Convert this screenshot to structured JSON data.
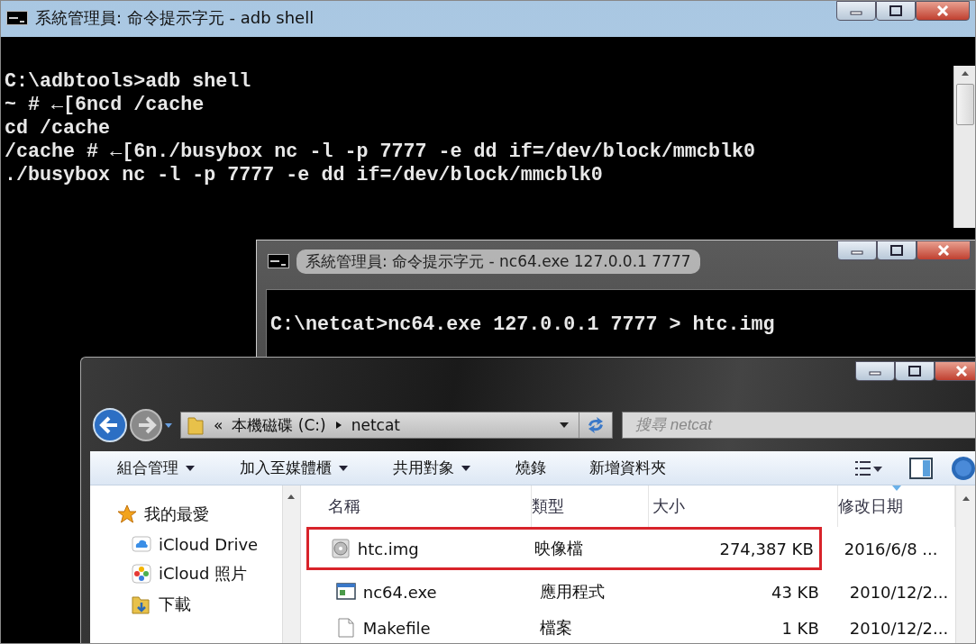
{
  "adb_window": {
    "title": "系統管理員: 命令提示字元 - adb shell",
    "lines": [
      "C:\\adbtools>adb shell",
      "~ # ←[6ncd /cache",
      "cd /cache",
      "/cache # ←[6n./busybox nc -l -p 7777 -e dd if=/dev/block/mmcblk0",
      "./busybox nc -l -p 7777 -e dd if=/dev/block/mmcblk0"
    ]
  },
  "netcat_window": {
    "title": "系統管理員: 命令提示字元 - nc64.exe  127.0.0.1 7777",
    "lines": [
      "C:\\netcat>nc64.exe 127.0.0.1 7777 > htc.img"
    ]
  },
  "explorer_window": {
    "address": {
      "overflow": "«",
      "parts": [
        "本機磁碟 (C:)",
        "netcat"
      ]
    },
    "search": {
      "placeholder": "搜尋 netcat"
    },
    "toolbar": [
      {
        "label": "組合管理",
        "has_menu": true
      },
      {
        "label": "加入至媒體櫃",
        "has_menu": true
      },
      {
        "label": "共用對象",
        "has_menu": true
      },
      {
        "label": "燒錄",
        "has_menu": false
      },
      {
        "label": "新增資料夾",
        "has_menu": false
      }
    ],
    "sidebar": {
      "items": [
        {
          "label": "我的最愛",
          "kind": "star",
          "children": [
            {
              "label": "iCloud Drive",
              "kind": "cloud"
            },
            {
              "label": "iCloud 照片",
              "kind": "photos"
            },
            {
              "label": "下載",
              "kind": "download"
            }
          ]
        }
      ]
    },
    "columns": [
      {
        "label": "名稱",
        "sorted": false
      },
      {
        "label": "類型",
        "sorted": false
      },
      {
        "label": "大小",
        "sorted": false
      },
      {
        "label": "修改日期",
        "sorted": true
      }
    ],
    "rows": [
      {
        "name": "htc.img",
        "type": "映像檔",
        "size": "274,387 KB",
        "modified": "2016/6/8 ...",
        "kind": "disc",
        "highlighted": true
      },
      {
        "name": "nc64.exe",
        "type": "應用程式",
        "size": "43 KB",
        "modified": "2010/12/2...",
        "kind": "exe",
        "highlighted": false
      },
      {
        "name": "Makefile",
        "type": "檔案",
        "size": "1 KB",
        "modified": "2010/12/2...",
        "kind": "file",
        "highlighted": false
      }
    ]
  }
}
